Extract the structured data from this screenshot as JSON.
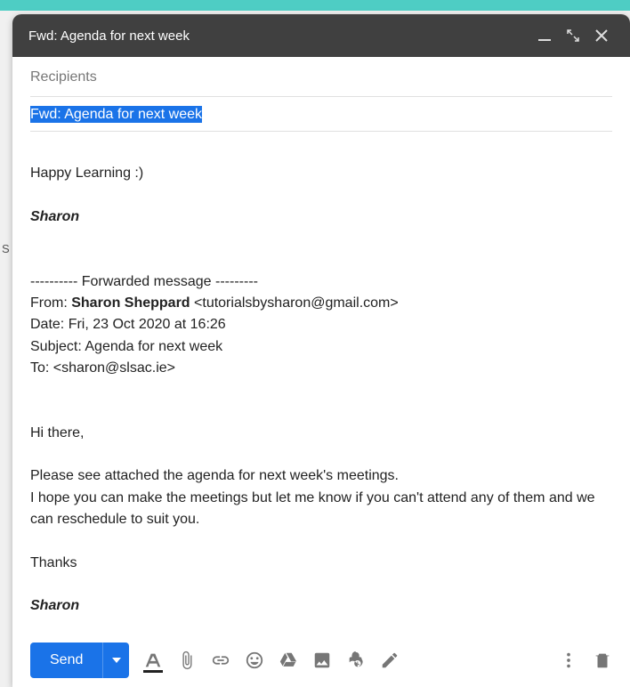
{
  "header": {
    "title": "Fwd: Agenda for next week"
  },
  "fields": {
    "recipients_placeholder": "Recipients",
    "subject": "Fwd: Agenda for next week"
  },
  "body": {
    "greeting": "Happy Learning :)",
    "signature1": "Sharon",
    "fwd_divider": "---------- Forwarded message ---------",
    "from_label": "From: ",
    "from_name": "Sharon Sheppard",
    "from_email": " <tutorialsbysharon@gmail.com>",
    "date_line": "Date: Fri, 23 Oct 2020 at 16:26",
    "subject_line": "Subject: Agenda for next week",
    "to_line": "To: <sharon@slsac.ie>",
    "p1": "Hi there,",
    "p2": "Please see attached the agenda for next week's meetings.",
    "p3": "I hope you can make the meetings but let me know if you can't attend any of them and we can reschedule to suit you.",
    "thanks": "Thanks",
    "signature2": "Sharon"
  },
  "toolbar": {
    "send_label": "Send"
  },
  "bg_partial": "S"
}
